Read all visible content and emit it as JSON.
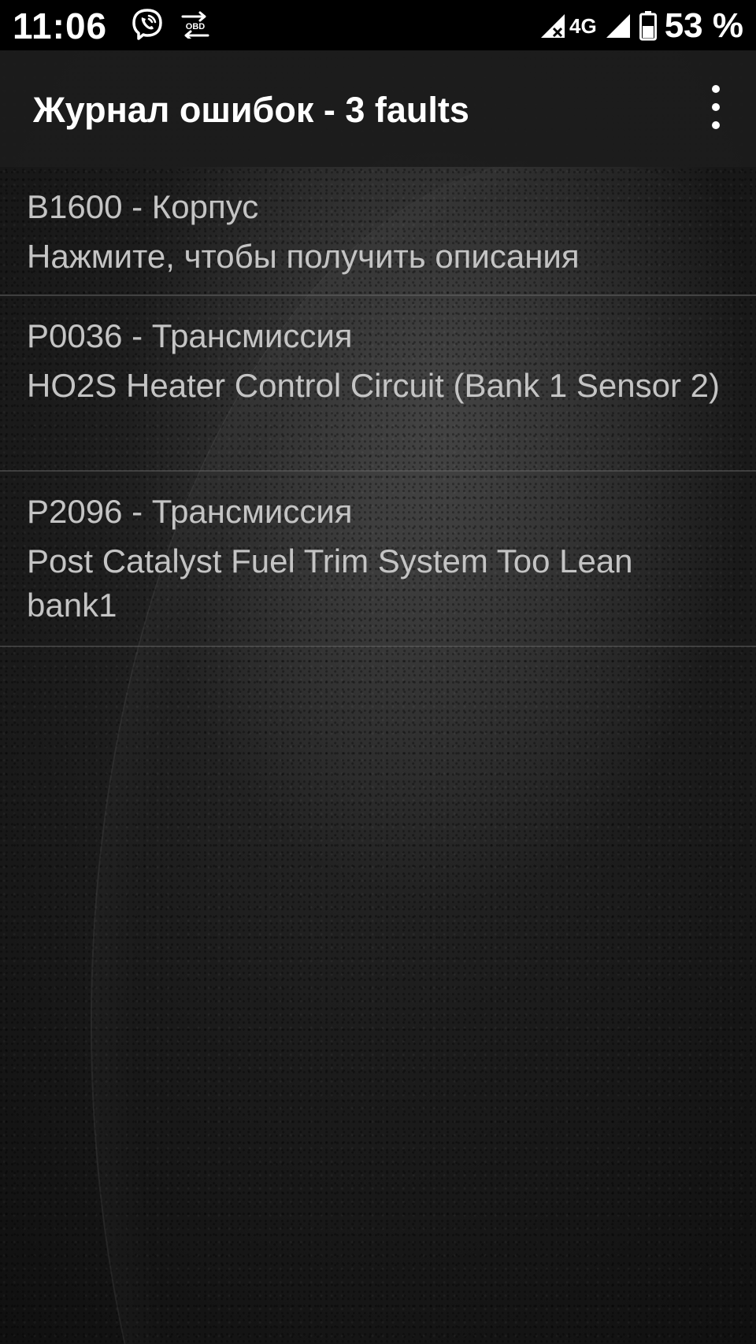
{
  "status_bar": {
    "time": "11:06",
    "left_icons": [
      "viber-icon",
      "obd-transfer-icon"
    ],
    "network_type": "4G",
    "battery_percent": "53 %"
  },
  "app_bar": {
    "title": "Журнал ошибок - 3 faults",
    "menu_icon": "overflow-menu-icon"
  },
  "faults": [
    {
      "code_line": "B1600 - Корпус",
      "description": "Нажмите, чтобы получить описания"
    },
    {
      "code_line": "P0036 - Трансмиссия",
      "description": "HO2S Heater Control Circuit (Bank 1 Sensor 2)"
    },
    {
      "code_line": "P2096 - Трансмиссия",
      "description": "Post Catalyst Fuel Trim System Too Lean bank1"
    }
  ]
}
